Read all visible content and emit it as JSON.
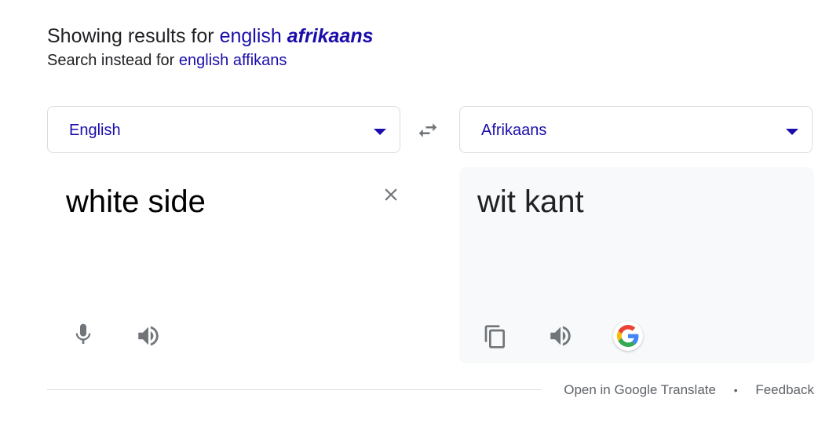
{
  "spelling": {
    "showing_prefix": "Showing results for",
    "showing_query_plain": "english",
    "showing_query_corrected": "afrikaans",
    "instead_prefix": "Search instead for",
    "instead_query": "english affikans"
  },
  "translator": {
    "source_language": "English",
    "target_language": "Afrikaans",
    "source_text": "white side",
    "translated_text": "wit kant"
  },
  "icons": {
    "swap": "swap-horiz-icon",
    "clear": "close-icon",
    "mic": "microphone-icon",
    "speaker": "volume-up-icon",
    "copy": "copy-icon",
    "google": "google-g-icon"
  },
  "footer": {
    "open_link": "Open in Google Translate",
    "separator": "•",
    "feedback_link": "Feedback"
  },
  "colors": {
    "link": "#1a0dab",
    "icon": "#70757a",
    "output_bg": "#f8f9fa"
  }
}
